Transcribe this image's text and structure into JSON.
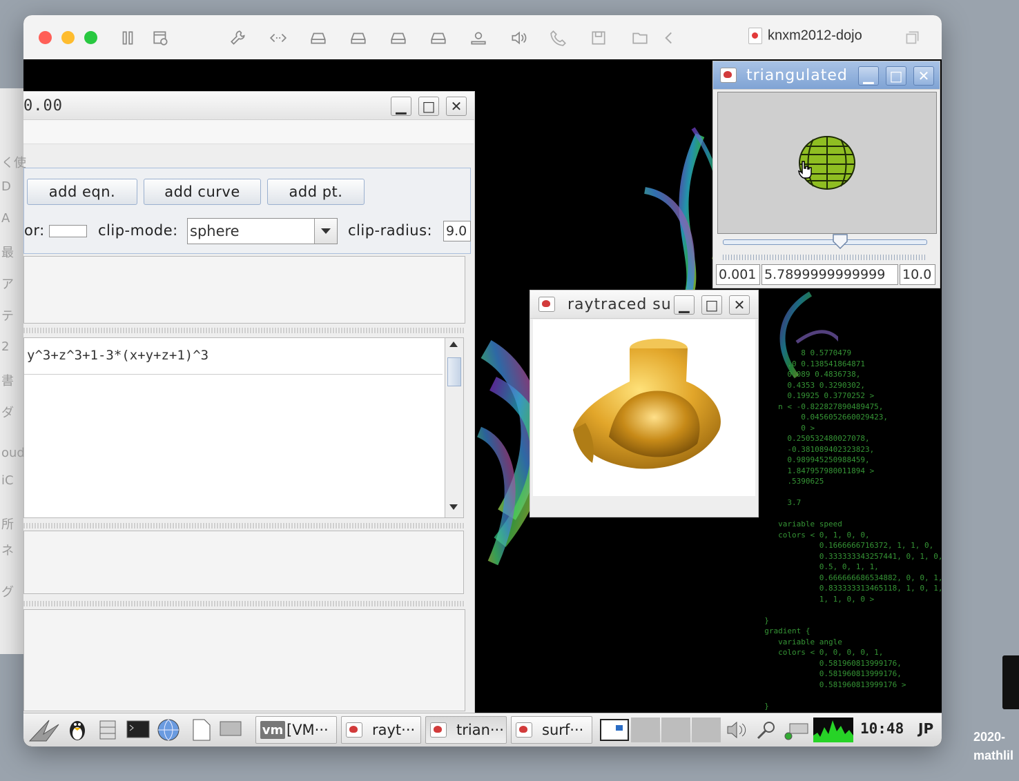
{
  "host": {
    "title": "knxm2012-dojo",
    "toolbar_icons": [
      "sidebar-icon",
      "snapshot-icon",
      "wrench-icon",
      "code-icon",
      "drive-icon",
      "drive-icon",
      "drive-icon",
      "drive-icon",
      "user-icon",
      "speaker-icon",
      "phone-icon",
      "save-icon",
      "folder-icon",
      "back-icon"
    ]
  },
  "main_window": {
    "title": "0.00",
    "buttons": {
      "add_eqn": "add eqn.",
      "add_curve": "add curve",
      "add_pt": "add pt."
    },
    "color_label": "or:",
    "clip_mode_label": "clip-mode:",
    "clip_mode_value": "sphere",
    "clip_radius_label": "clip-radius:",
    "clip_radius_value": "9.0",
    "equation_text": "y^3+z^3+1-3*(x+y+z+1)^3"
  },
  "triangulated_window": {
    "title": "triangulated",
    "slider_value": 0.579,
    "min_field": "0.001",
    "value_field": "5.7899999999999",
    "max_field": "10.0"
  },
  "raytraced_window": {
    "title": "raytraced su"
  },
  "taskbar": {
    "tasks": [
      "[VM···",
      "rayt···",
      "trian···",
      "surf···"
    ],
    "vm_badge": "vm",
    "clock": "10:48",
    "ime": "JP"
  },
  "finder_sliver": [
    "く使",
    "D",
    "A",
    "最",
    "ア",
    "テ",
    "2",
    "書",
    "ダ",
    "oud",
    "iC",
    "所",
    "ネ",
    "グ"
  ],
  "terminal_text": [
    "          8 0.5770479",
    "       .0 0.138541864871",
    "       0.089 0.4836738,",
    "       0.4353 0.3290302,",
    "       0.19925 0.3770252 >",
    "     n < -0.822827890489475,",
    "          0.0456052660029423,",
    "          0 >",
    "       0.250532480027078,",
    "       -0.381089402323823,",
    "       0.989945250988459,",
    "       1.847957980011894 >",
    "       .5390625",
    "",
    "       3.7",
    "",
    "     variable speed",
    "     colors < 0, 1, 0, 0,",
    "              0.1666666716372, 1, 1, 0,",
    "              0.333333343257441, 0, 1, 0,",
    "              0.5, 0, 1, 1,",
    "              0.666666686534882, 0, 0, 1,",
    "              0.833333313465118, 1, 0, 1,",
    "              1, 1, 0, 0 >",
    "",
    "  }",
    "  gradient {",
    "     variable angle",
    "     colors < 0, 0, 0, 0, 1,",
    "              0.581960813999176,",
    "              0.581960813999176,",
    "              0.581960813999176 >",
    "",
    "  }"
  ],
  "corner_caption": [
    "2020-",
    "mathlil"
  ]
}
